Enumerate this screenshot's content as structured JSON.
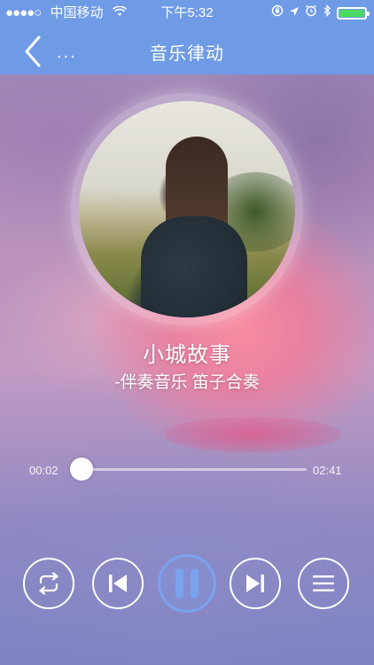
{
  "status_bar": {
    "signal": "●●●●○",
    "carrier": "中国移动",
    "time": "下午5:32"
  },
  "nav": {
    "back_label": "...",
    "title": "音乐律动"
  },
  "song": {
    "title": "小城故事",
    "subtitle": "-伴奏音乐 笛子合奏"
  },
  "progress": {
    "current": "00:02",
    "total": "02:41",
    "fraction": 0.013
  },
  "controls": {
    "state": "playing",
    "buttons": [
      "repeat-icon",
      "previous-icon",
      "pause-icon",
      "next-icon",
      "playlist-icon"
    ]
  },
  "colors": {
    "nav_bar": "#6f9be6",
    "play_accent": "#7aa3ee",
    "battery": "#4cd964"
  }
}
